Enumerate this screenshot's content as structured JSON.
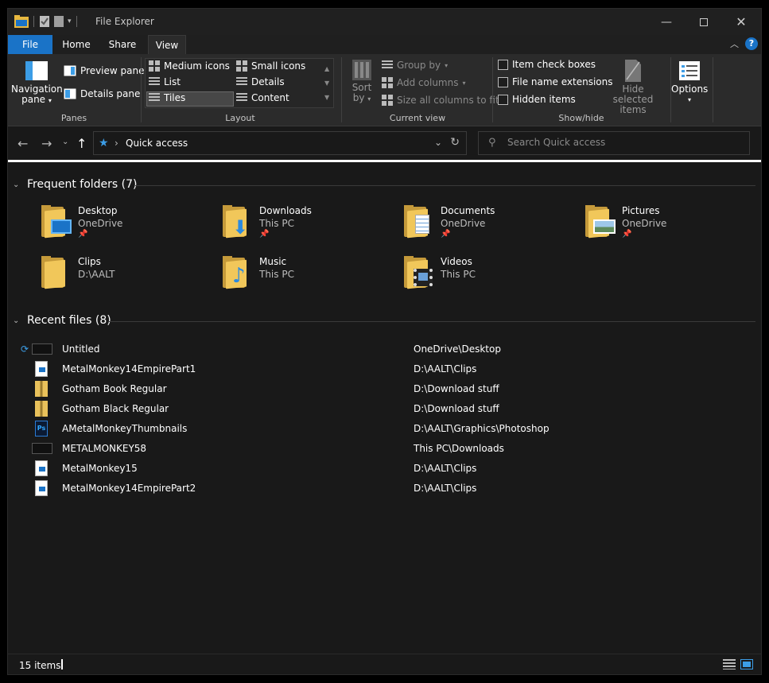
{
  "window": {
    "title": "File Explorer"
  },
  "ribbon": {
    "tabs": [
      {
        "label": "File"
      },
      {
        "label": "Home"
      },
      {
        "label": "Share"
      },
      {
        "label": "View"
      }
    ],
    "panes": {
      "group_label": "Panes",
      "navigation_pane": "Navigation",
      "navigation_pane_2": "pane",
      "preview_pane": "Preview pane",
      "details_pane": "Details pane"
    },
    "layout": {
      "group_label": "Layout",
      "options": [
        "Medium icons",
        "Small icons",
        "List",
        "Details",
        "Tiles",
        "Content"
      ],
      "selected": "Tiles"
    },
    "current_view": {
      "group_label": "Current view",
      "sort_by": "Sort",
      "sort_by_2": "by",
      "group_by": "Group by",
      "add_columns": "Add columns",
      "size_columns": "Size all columns to fit"
    },
    "show_hide": {
      "group_label": "Show/hide",
      "item_check_boxes": "Item check boxes",
      "file_name_extensions": "File name extensions",
      "hidden_items": "Hidden items",
      "hide_selected": "Hide selected",
      "hide_selected_2": "items"
    },
    "options": {
      "label": "Options"
    }
  },
  "address": {
    "path": "Quick access",
    "search_placeholder": "Search Quick access"
  },
  "frequent_folders": {
    "title": "Frequent folders (7)",
    "items": [
      {
        "name": "Desktop",
        "location": "OneDrive",
        "pinned": true
      },
      {
        "name": "Downloads",
        "location": "This PC",
        "pinned": true
      },
      {
        "name": "Documents",
        "location": "OneDrive",
        "pinned": true
      },
      {
        "name": "Pictures",
        "location": "OneDrive",
        "pinned": true
      },
      {
        "name": "Clips",
        "location": "D:\\AALT",
        "pinned": false
      },
      {
        "name": "Music",
        "location": "This PC",
        "pinned": false
      },
      {
        "name": "Videos",
        "location": "This PC",
        "pinned": false
      }
    ]
  },
  "recent_files": {
    "title": "Recent files (8)",
    "items": [
      {
        "name": "Untitled",
        "location": "OneDrive\\Desktop",
        "icon": "video-thumbnail-icon"
      },
      {
        "name": "MetalMonkey14EmpirePart1",
        "location": "D:\\AALT\\Clips",
        "icon": "video-file-icon"
      },
      {
        "name": "Gotham Book Regular",
        "location": "D:\\Download stuff",
        "icon": "zip-file-icon"
      },
      {
        "name": "Gotham Black Regular",
        "location": "D:\\Download stuff",
        "icon": "zip-file-icon"
      },
      {
        "name": "AMetalMonkeyThumbnails",
        "location": "D:\\AALT\\Graphics\\Photoshop",
        "icon": "photoshop-file-icon"
      },
      {
        "name": "METALMONKEY58",
        "location": "This PC\\Downloads",
        "icon": "video-thumbnail-icon"
      },
      {
        "name": "MetalMonkey15",
        "location": "D:\\AALT\\Clips",
        "icon": "video-file-icon"
      },
      {
        "name": "MetalMonkey14EmpirePart2",
        "location": "D:\\AALT\\Clips",
        "icon": "video-file-icon"
      }
    ]
  },
  "status": {
    "item_count": "15 items"
  },
  "colors": {
    "accent": "#1a73c7",
    "background": "#191919",
    "ribbon": "#2b2b2b",
    "folder": "#f1c75a"
  }
}
